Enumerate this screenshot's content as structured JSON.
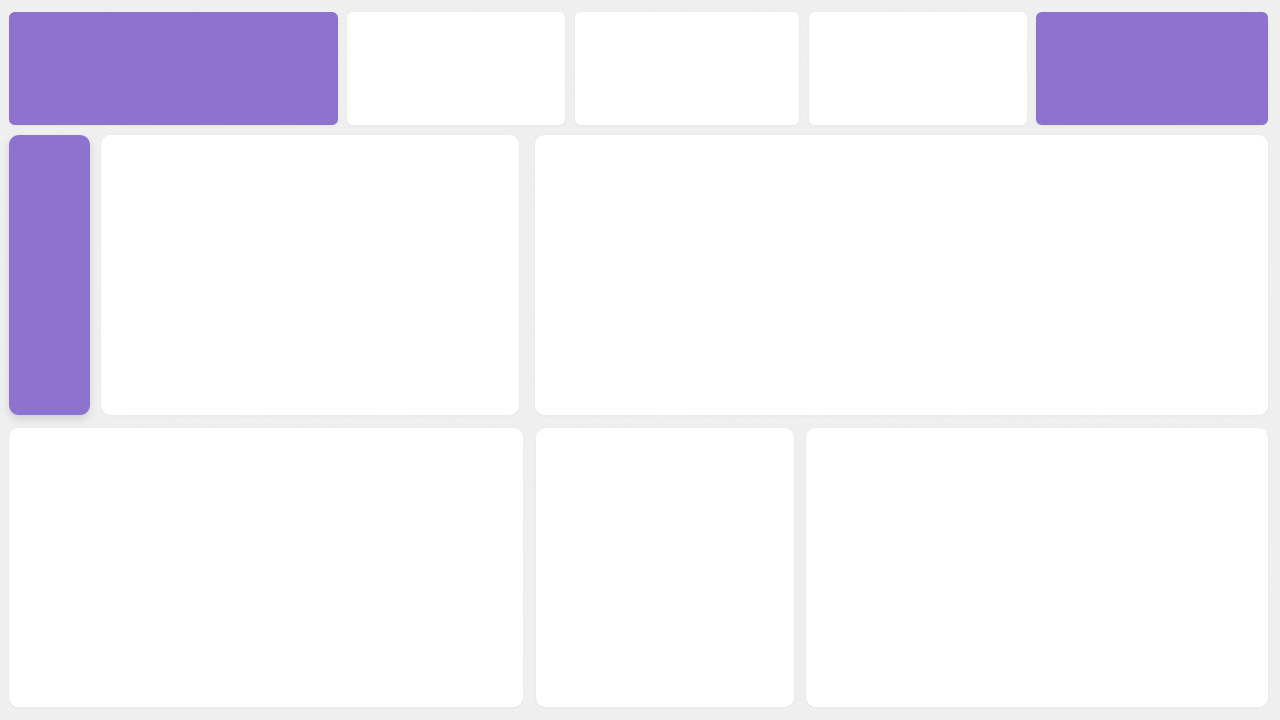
{
  "theme": {
    "accent": "#8e72cf",
    "panel": "#ffffff",
    "background": "#f1f1f1"
  },
  "top_row": {
    "tiles": [
      {
        "id": "top-1",
        "style": "accent"
      },
      {
        "id": "top-2",
        "style": "panel"
      },
      {
        "id": "top-3",
        "style": "panel"
      },
      {
        "id": "top-4",
        "style": "panel"
      },
      {
        "id": "top-5",
        "style": "accent"
      }
    ]
  },
  "middle_row": {
    "tiles": [
      {
        "id": "mid-1",
        "style": "accent"
      },
      {
        "id": "mid-2",
        "style": "panel"
      },
      {
        "id": "mid-3",
        "style": "panel"
      }
    ]
  },
  "bottom_row": {
    "tiles": [
      {
        "id": "bot-1",
        "style": "panel"
      },
      {
        "id": "bot-2",
        "style": "panel"
      },
      {
        "id": "bot-3",
        "style": "panel"
      }
    ]
  }
}
